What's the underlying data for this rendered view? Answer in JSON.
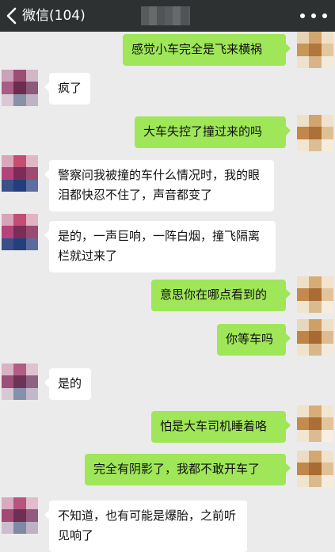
{
  "header": {
    "back_label": "微信(104)",
    "back_icon": "chevron-left-icon",
    "more_icon": "more-dots-icon"
  },
  "colors": {
    "header_bg": "#2e3132",
    "chat_bg": "#ebebeb",
    "outgoing_bubble": "#9fe658",
    "incoming_bubble": "#ffffff"
  },
  "messages": [
    {
      "side": "out",
      "text": "感觉小车完全是飞来横祸"
    },
    {
      "side": "in",
      "text": "疯了"
    },
    {
      "side": "out",
      "text": "大车失控了撞过来的吗"
    },
    {
      "side": "in",
      "text": "警察问我被撞的车什么情况时，我的眼泪都快忍不住了，声音都变了"
    },
    {
      "side": "in",
      "text": "是的，一声巨响，一阵白烟，撞飞隔离栏就过来了"
    },
    {
      "side": "out",
      "text": "意思你在哪点看到的"
    },
    {
      "side": "out",
      "text": "你等车吗"
    },
    {
      "side": "in",
      "text": "是的"
    },
    {
      "side": "out",
      "text": "怕是大车司机睡着咯"
    },
    {
      "side": "out",
      "text": "完全有阴影了，我都不敢开车了"
    },
    {
      "side": "in",
      "text": "不知道，也有可能是爆胎，之前听见响了"
    }
  ]
}
